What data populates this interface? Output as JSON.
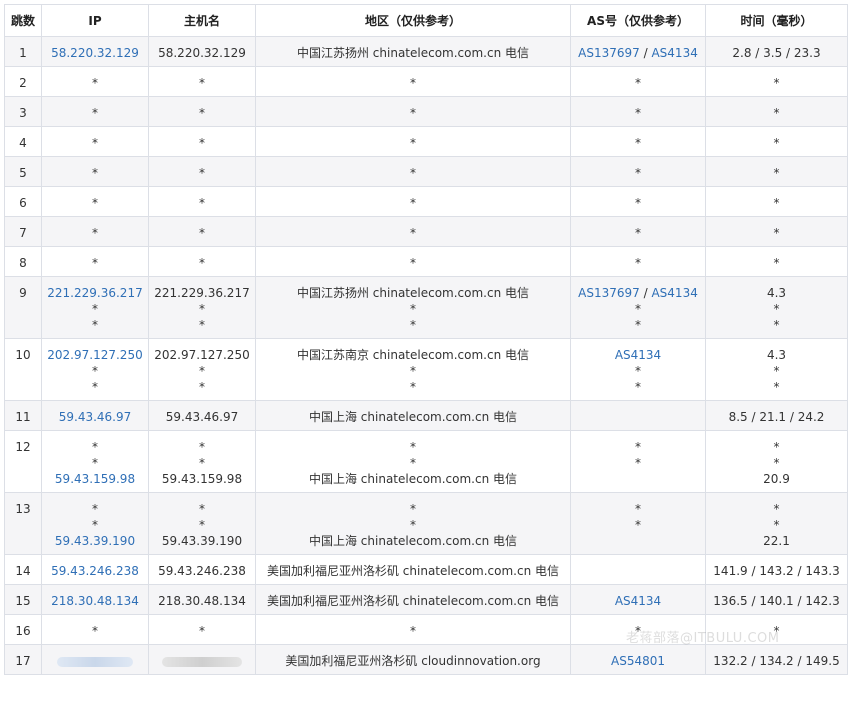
{
  "headers": {
    "hop": "跳数",
    "ip": "IP",
    "host": "主机名",
    "region": "地区（仅供参考）",
    "as": "AS号（仅供参考）",
    "time": "时间（毫秒）"
  },
  "rows": [
    {
      "hop": "1",
      "lines": [
        {
          "ip": "58.220.32.129",
          "host": "58.220.32.129",
          "region": "中国江苏扬州 chinatelecom.com.cn 电信",
          "as": [
            "AS137697",
            "AS4134"
          ],
          "time": "2.8 / 3.5 / 23.3"
        }
      ]
    },
    {
      "hop": "2",
      "lines": [
        {
          "ip": "*",
          "host": "*",
          "region": "*",
          "as": [
            "*"
          ],
          "time": "*"
        }
      ]
    },
    {
      "hop": "3",
      "lines": [
        {
          "ip": "*",
          "host": "*",
          "region": "*",
          "as": [
            "*"
          ],
          "time": "*"
        }
      ]
    },
    {
      "hop": "4",
      "lines": [
        {
          "ip": "*",
          "host": "*",
          "region": "*",
          "as": [
            "*"
          ],
          "time": "*"
        }
      ]
    },
    {
      "hop": "5",
      "lines": [
        {
          "ip": "*",
          "host": "*",
          "region": "*",
          "as": [
            "*"
          ],
          "time": "*"
        }
      ]
    },
    {
      "hop": "6",
      "lines": [
        {
          "ip": "*",
          "host": "*",
          "region": "*",
          "as": [
            "*"
          ],
          "time": "*"
        }
      ]
    },
    {
      "hop": "7",
      "lines": [
        {
          "ip": "*",
          "host": "*",
          "region": "*",
          "as": [
            "*"
          ],
          "time": "*"
        }
      ]
    },
    {
      "hop": "8",
      "lines": [
        {
          "ip": "*",
          "host": "*",
          "region": "*",
          "as": [
            "*"
          ],
          "time": "*"
        }
      ]
    },
    {
      "hop": "9",
      "lines": [
        {
          "ip": "221.229.36.217",
          "host": "221.229.36.217",
          "region": "中国江苏扬州 chinatelecom.com.cn 电信",
          "as": [
            "AS137697",
            "AS4134"
          ],
          "time": "4.3"
        },
        {
          "ip": "*",
          "host": "*",
          "region": "*",
          "as": [
            "*"
          ],
          "time": "*"
        },
        {
          "ip": "*",
          "host": "*",
          "region": "*",
          "as": [
            "*"
          ],
          "time": "*"
        }
      ]
    },
    {
      "hop": "10",
      "lines": [
        {
          "ip": "202.97.127.250",
          "host": "202.97.127.250",
          "region": "中国江苏南京 chinatelecom.com.cn 电信",
          "as": [
            "AS4134"
          ],
          "time": "4.3"
        },
        {
          "ip": "*",
          "host": "*",
          "region": "*",
          "as": [
            "*"
          ],
          "time": "*"
        },
        {
          "ip": "*",
          "host": "*",
          "region": "*",
          "as": [
            "*"
          ],
          "time": "*"
        }
      ]
    },
    {
      "hop": "11",
      "lines": [
        {
          "ip": "59.43.46.97",
          "host": "59.43.46.97",
          "region": "中国上海 chinatelecom.com.cn 电信",
          "as": [],
          "time": "8.5 / 21.1 / 24.2"
        }
      ]
    },
    {
      "hop": "12",
      "lines": [
        {
          "ip": "*",
          "host": "*",
          "region": "*",
          "as": [
            "*"
          ],
          "time": "*"
        },
        {
          "ip": "*",
          "host": "*",
          "region": "*",
          "as": [
            "*"
          ],
          "time": "*"
        },
        {
          "ip": "59.43.159.98",
          "host": "59.43.159.98",
          "region": "中国上海 chinatelecom.com.cn 电信",
          "as": [],
          "time": "20.9"
        }
      ]
    },
    {
      "hop": "13",
      "lines": [
        {
          "ip": "*",
          "host": "*",
          "region": "*",
          "as": [
            "*"
          ],
          "time": "*"
        },
        {
          "ip": "*",
          "host": "*",
          "region": "*",
          "as": [
            "*"
          ],
          "time": "*"
        },
        {
          "ip": "59.43.39.190",
          "host": "59.43.39.190",
          "region": "中国上海 chinatelecom.com.cn 电信",
          "as": [],
          "time": "22.1"
        }
      ]
    },
    {
      "hop": "14",
      "lines": [
        {
          "ip": "59.43.246.238",
          "host": "59.43.246.238",
          "region": "美国加利福尼亚州洛杉矶 chinatelecom.com.cn 电信",
          "as": [],
          "time": "141.9 / 143.2 / 143.3"
        }
      ]
    },
    {
      "hop": "15",
      "lines": [
        {
          "ip": "218.30.48.134",
          "host": "218.30.48.134",
          "region": "美国加利福尼亚州洛杉矶 chinatelecom.com.cn 电信",
          "as": [
            "AS4134"
          ],
          "time": "136.5 / 140.1 / 142.3"
        }
      ]
    },
    {
      "hop": "16",
      "lines": [
        {
          "ip": "*",
          "host": "*",
          "region": "*",
          "as": [
            "*"
          ],
          "time": "*"
        }
      ]
    },
    {
      "hop": "17",
      "lines": [
        {
          "ip": "",
          "host": "",
          "region": "美国加利福尼亚州洛杉矶 cloudinnovation.org",
          "as": [
            "AS54801"
          ],
          "time": "132.2 / 134.2 / 149.5",
          "redacted": true
        }
      ]
    }
  ],
  "watermark": "老蒋部落@ITBULU.COM"
}
